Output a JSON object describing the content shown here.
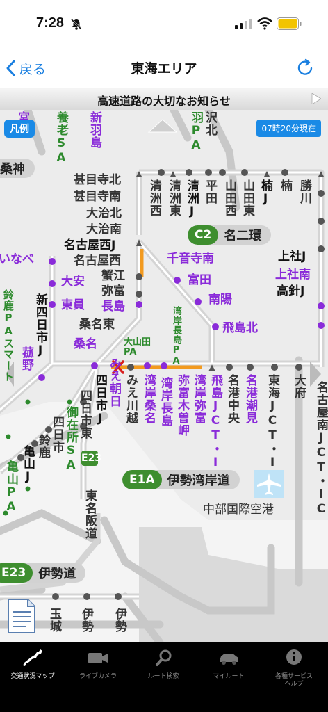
{
  "status_bar": {
    "time": "7:28"
  },
  "nav": {
    "back_label": "戻る",
    "title": "東海エリア"
  },
  "notice": {
    "text": "高速道路の大切なお知らせ"
  },
  "map": {
    "legend_label": "凡例",
    "timestamp": "07時20分現在",
    "route_badges": {
      "c2": {
        "code": "C2",
        "name": "名二環"
      },
      "e1a": {
        "code": "E1A",
        "name": "伊勢湾岸道"
      },
      "e23": {
        "code": "E23",
        "name": "伊勢道"
      }
    },
    "e23_shield": "E23",
    "shield_road_name": "東名阪道",
    "left_edge_label": "桑神",
    "labels": {
      "tsuji": "宮津",
      "yoro_sa": "養老SA",
      "shinhashima": "新羽島",
      "sawa": "沢北",
      "naba_sa": "羽PA",
      "chitose_s": "大",
      "jimokuji_n": "甚目寺北",
      "jimokuji_s": "甚目寺南",
      "oharu_n": "大治北",
      "oharu_s": "大治南",
      "nagoya_nishi_j": "名古屋西J",
      "nagoya_nishi": "名古屋西",
      "kanie": "蟹江",
      "yatomi": "弥富",
      "kuwana_higashi": "桑名東",
      "kiyosu_nishi": "清洲西",
      "kiyosu_higashi": "清洲東",
      "kiyosu_j": "清洲J",
      "hirata": "平田",
      "yamada_nishi": "山田西",
      "yamada_higashi": "山田東",
      "kusunoki_j": "楠J",
      "kusunoki": "楠",
      "katsukawa": "勝川",
      "kamiyashiro_j": "上社J",
      "kamiyashiro_minami": "上社南",
      "takabari_j": "高針J",
      "chiyoji": "千音寺南",
      "tomida": "富田",
      "nanyo": "南陽",
      "tobishima_kita": "飛島北",
      "inabe": "いなべ",
      "oyasu": "大安",
      "toin": "東員",
      "nagashima": "長島",
      "kuwana": "桑名",
      "shinyokkaichi_j": "新四日市J",
      "suzuka_pa": "鈴鹿PAスマート",
      "komono": "菰野",
      "wangan_nagashima_pa": "湾岸長島PA",
      "oyamada_pa": "大山田PA",
      "yokkaichi_j": "四日市J",
      "mie_asahi": "みえ朝日",
      "mie_kawagoe": "みえ川越",
      "wangan_kuwana": "湾岸桑名",
      "wangan_nagashima": "湾岸長島",
      "yatomi_kisozaki": "弥富木曽岬",
      "wangan_yatomi": "湾岸弥富",
      "tobishima_jct": "飛島JCT・IC",
      "meiko_chuo": "名港中央",
      "meiko_shiomi": "名港潮見",
      "tokai_jct": "東海JCT・IC",
      "obu": "大府",
      "nagoya_minami_jct": "名古屋南JCT・IC",
      "yokkaichi_higashi": "四日市東",
      "mitaki_sa": "御在所SA",
      "yokkaichi": "四日市",
      "suzuka": "鈴鹿",
      "kameyama_j": "亀山J",
      "kameyama_pa": "亀山PA",
      "centrair": "中部国際空港",
      "tamaki": "玉城",
      "ise_w": "伊勢",
      "ise_e": "伊勢"
    }
  },
  "tabs": [
    {
      "label": "交通状況マップ",
      "icon": "japan-map-icon",
      "active": true
    },
    {
      "label": "ライブカメラ",
      "icon": "video-camera-icon",
      "active": false
    },
    {
      "label": "ルート検索",
      "icon": "magnifier-icon",
      "active": false
    },
    {
      "label": "マイルート",
      "icon": "car-icon",
      "active": false
    },
    {
      "label": "各種サービスヘルプ",
      "icon": "info-icon",
      "active": false
    }
  ],
  "colors": {
    "accent": "#1a7fe0",
    "road_congested": "#f29a1f",
    "ic_purple": "#8a2bd9",
    "sa_green": "#2d8a2d",
    "route_green": "#3e8e2f",
    "closure_red": "#d81e1e"
  }
}
